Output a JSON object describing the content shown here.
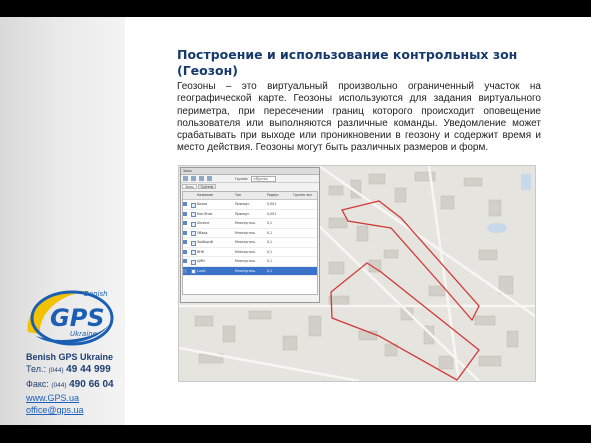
{
  "logo": {
    "brand": "GPS",
    "top": "Benish",
    "bottom": "Ukraine"
  },
  "contacts": {
    "company": "Benish GPS Ukraine",
    "phone_label": "Тел.:",
    "phone_code": "(044)",
    "phone_number": "49 44 999",
    "fax_label": "Факс:",
    "fax_code": "(044)",
    "fax_number": "490 66 04",
    "website": "www.GPS.ua",
    "email": "office@gps.ua"
  },
  "slide": {
    "title": "Построение и использование контрольных зон (Геозон)",
    "body": "Геозоны – это виртуальный произвольно ограниченный участок на географической карте. Геозоны используются для задания виртуального периметра, при пересечении границ которого происходит оповещение пользователя или выполняются различные команды. Уведомление может срабатывать при выходе или проникновении в геозону и содержит время и место действия. Геозоны могут быть различных размеров и форм."
  },
  "app_panel": {
    "window_title": "Зоны",
    "group_label": "Группа:",
    "group_value": "<Пусто>",
    "tabs": [
      "Зоны",
      "Группы"
    ],
    "columns": [
      "Название",
      "Тип",
      "Радиус",
      "Группа зон"
    ],
    "rows": [
      {
        "name": "Белая",
        "type": "Прямоуг.",
        "radius": "0,001"
      },
      {
        "name": "Кон.Ягов.",
        "type": "Прямоуг.",
        "radius": "0,001"
      },
      {
        "name": "Ukraine",
        "type": "Многоуголь.",
        "radius": "0,1"
      },
      {
        "name": "Обход",
        "type": "Многоуголь.",
        "radius": "0,1"
      },
      {
        "name": "ЗаоБорзй",
        "type": "Многоуголь.",
        "radius": "0,1"
      },
      {
        "name": "ИНК",
        "type": "Многоуголь.",
        "radius": "0,1"
      },
      {
        "name": "ЦМИ",
        "type": "Многоуголь.",
        "radius": "0,1"
      },
      {
        "name": "Lucid",
        "type": "Многоуголь.",
        "radius": "0,1"
      }
    ],
    "selected_row": 7
  },
  "colors": {
    "title": "#163a6b",
    "logo_blue": "#1a5fb4",
    "logo_yellow": "#f2c200",
    "geofence": "#d23a3a",
    "map_bg": "#e6e4df"
  }
}
